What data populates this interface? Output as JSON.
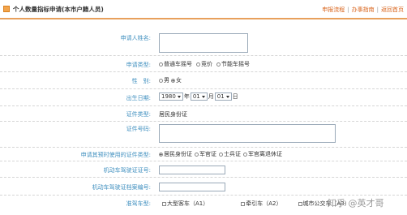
{
  "header": {
    "title": "个人数量指标申请(本市户籍人员)",
    "links": [
      "申报流程",
      "办事指南",
      "返回首页"
    ]
  },
  "form": {
    "applicant_name": {
      "label": "申请人姓名:",
      "value": ""
    },
    "apply_type": {
      "label": "申请类型:",
      "options": [
        "普通车摇号",
        "竞价",
        "节能车摇号"
      ],
      "selected": null
    },
    "gender": {
      "label": "性　别:",
      "options": [
        "男",
        "女"
      ],
      "selected": "女"
    },
    "birth_date": {
      "label": "出生日期:",
      "year": "1980",
      "year_unit": "年",
      "month": "01",
      "month_unit": "月",
      "day": "01",
      "day_unit": "日"
    },
    "id_type": {
      "label": "证件类型:",
      "value": "居民身份证"
    },
    "id_number": {
      "label": "证件号码:",
      "value": ""
    },
    "prev_id_type": {
      "label": "申请其预时使用的证件类型:",
      "options": [
        "居民身份证",
        "军官证",
        "士兵证",
        "军官离退休证"
      ],
      "selected": "居民身份证"
    },
    "license_number": {
      "label": "机动车驾驶证证号:",
      "value": ""
    },
    "license_file_number": {
      "label": "机动车驾驶证档案编号:",
      "value": ""
    },
    "vehicle_types": {
      "label": "准驾车型:",
      "options": [
        "大型客车（A1）",
        "牵引车（A2）",
        "城市公交车（A3）"
      ]
    }
  },
  "watermark": "知乎 @英才哥"
}
